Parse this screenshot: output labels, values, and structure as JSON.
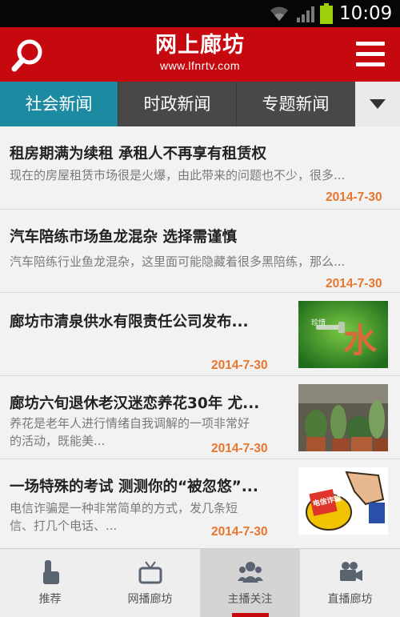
{
  "status_bar": {
    "time": "10:09",
    "icons": [
      "wifi-icon",
      "signal-icon",
      "battery-icon"
    ],
    "battery_color": "#9fd10b"
  },
  "header": {
    "title": "网上廊坊",
    "url": "www.lfnrtv.com",
    "left_icon": "search-icon",
    "right_icon": "menu-icon",
    "bg_color": "#c6090f"
  },
  "tabs": [
    {
      "label": "社会新闻",
      "active": true
    },
    {
      "label": "时政新闻",
      "active": false
    },
    {
      "label": "专题新闻",
      "active": false
    }
  ],
  "tabs_more_icon": "dropdown-triangle-icon",
  "accent_color": "#1c8aa0",
  "news": [
    {
      "title": "租房期满为续租 承租人不再享有租赁权",
      "summary": "现在的房屋租赁市场很是火爆，由此带来的问题也不少，很多...",
      "date": "2014-7-30"
    },
    {
      "title": "汽车陪练市场鱼龙混杂 选择需谨慎",
      "summary": "汽车陪练行业鱼龙混杂，这里面可能隐藏着很多黑陪练，那么...",
      "date": "2014-7-30"
    },
    {
      "title": "廊坊市清泉供水有限责任公司发布...",
      "summary": "",
      "date": "2014-7-30",
      "thumb_text": "水",
      "thumb_caption": "珍惜"
    },
    {
      "title": "廊坊六旬退休老汉迷恋养花30年 尤...",
      "summary_line1": "养花是老年人进行情绪自我调解的一项非常好",
      "summary_line2": "的活动，既能美...",
      "date": "2014-7-30"
    },
    {
      "title": "一场特殊的考试 测测你的“被忽悠”...",
      "summary_line1": "电信诈骗是一种非常简单的方式，发几条短",
      "summary_line2": "信、打几个电话、...",
      "date": "2014-7-30",
      "thumb_text": "电信诈骗"
    }
  ],
  "date_color": "#e8762e",
  "bottom_nav": [
    {
      "label": "推荐",
      "icon": "pointer-hand-icon",
      "active": false
    },
    {
      "label": "网播廊坊",
      "icon": "tv-icon",
      "active": false
    },
    {
      "label": "主播关注",
      "icon": "users-icon",
      "active": true
    },
    {
      "label": "直播廊坊",
      "icon": "video-camera-icon",
      "active": false
    }
  ]
}
